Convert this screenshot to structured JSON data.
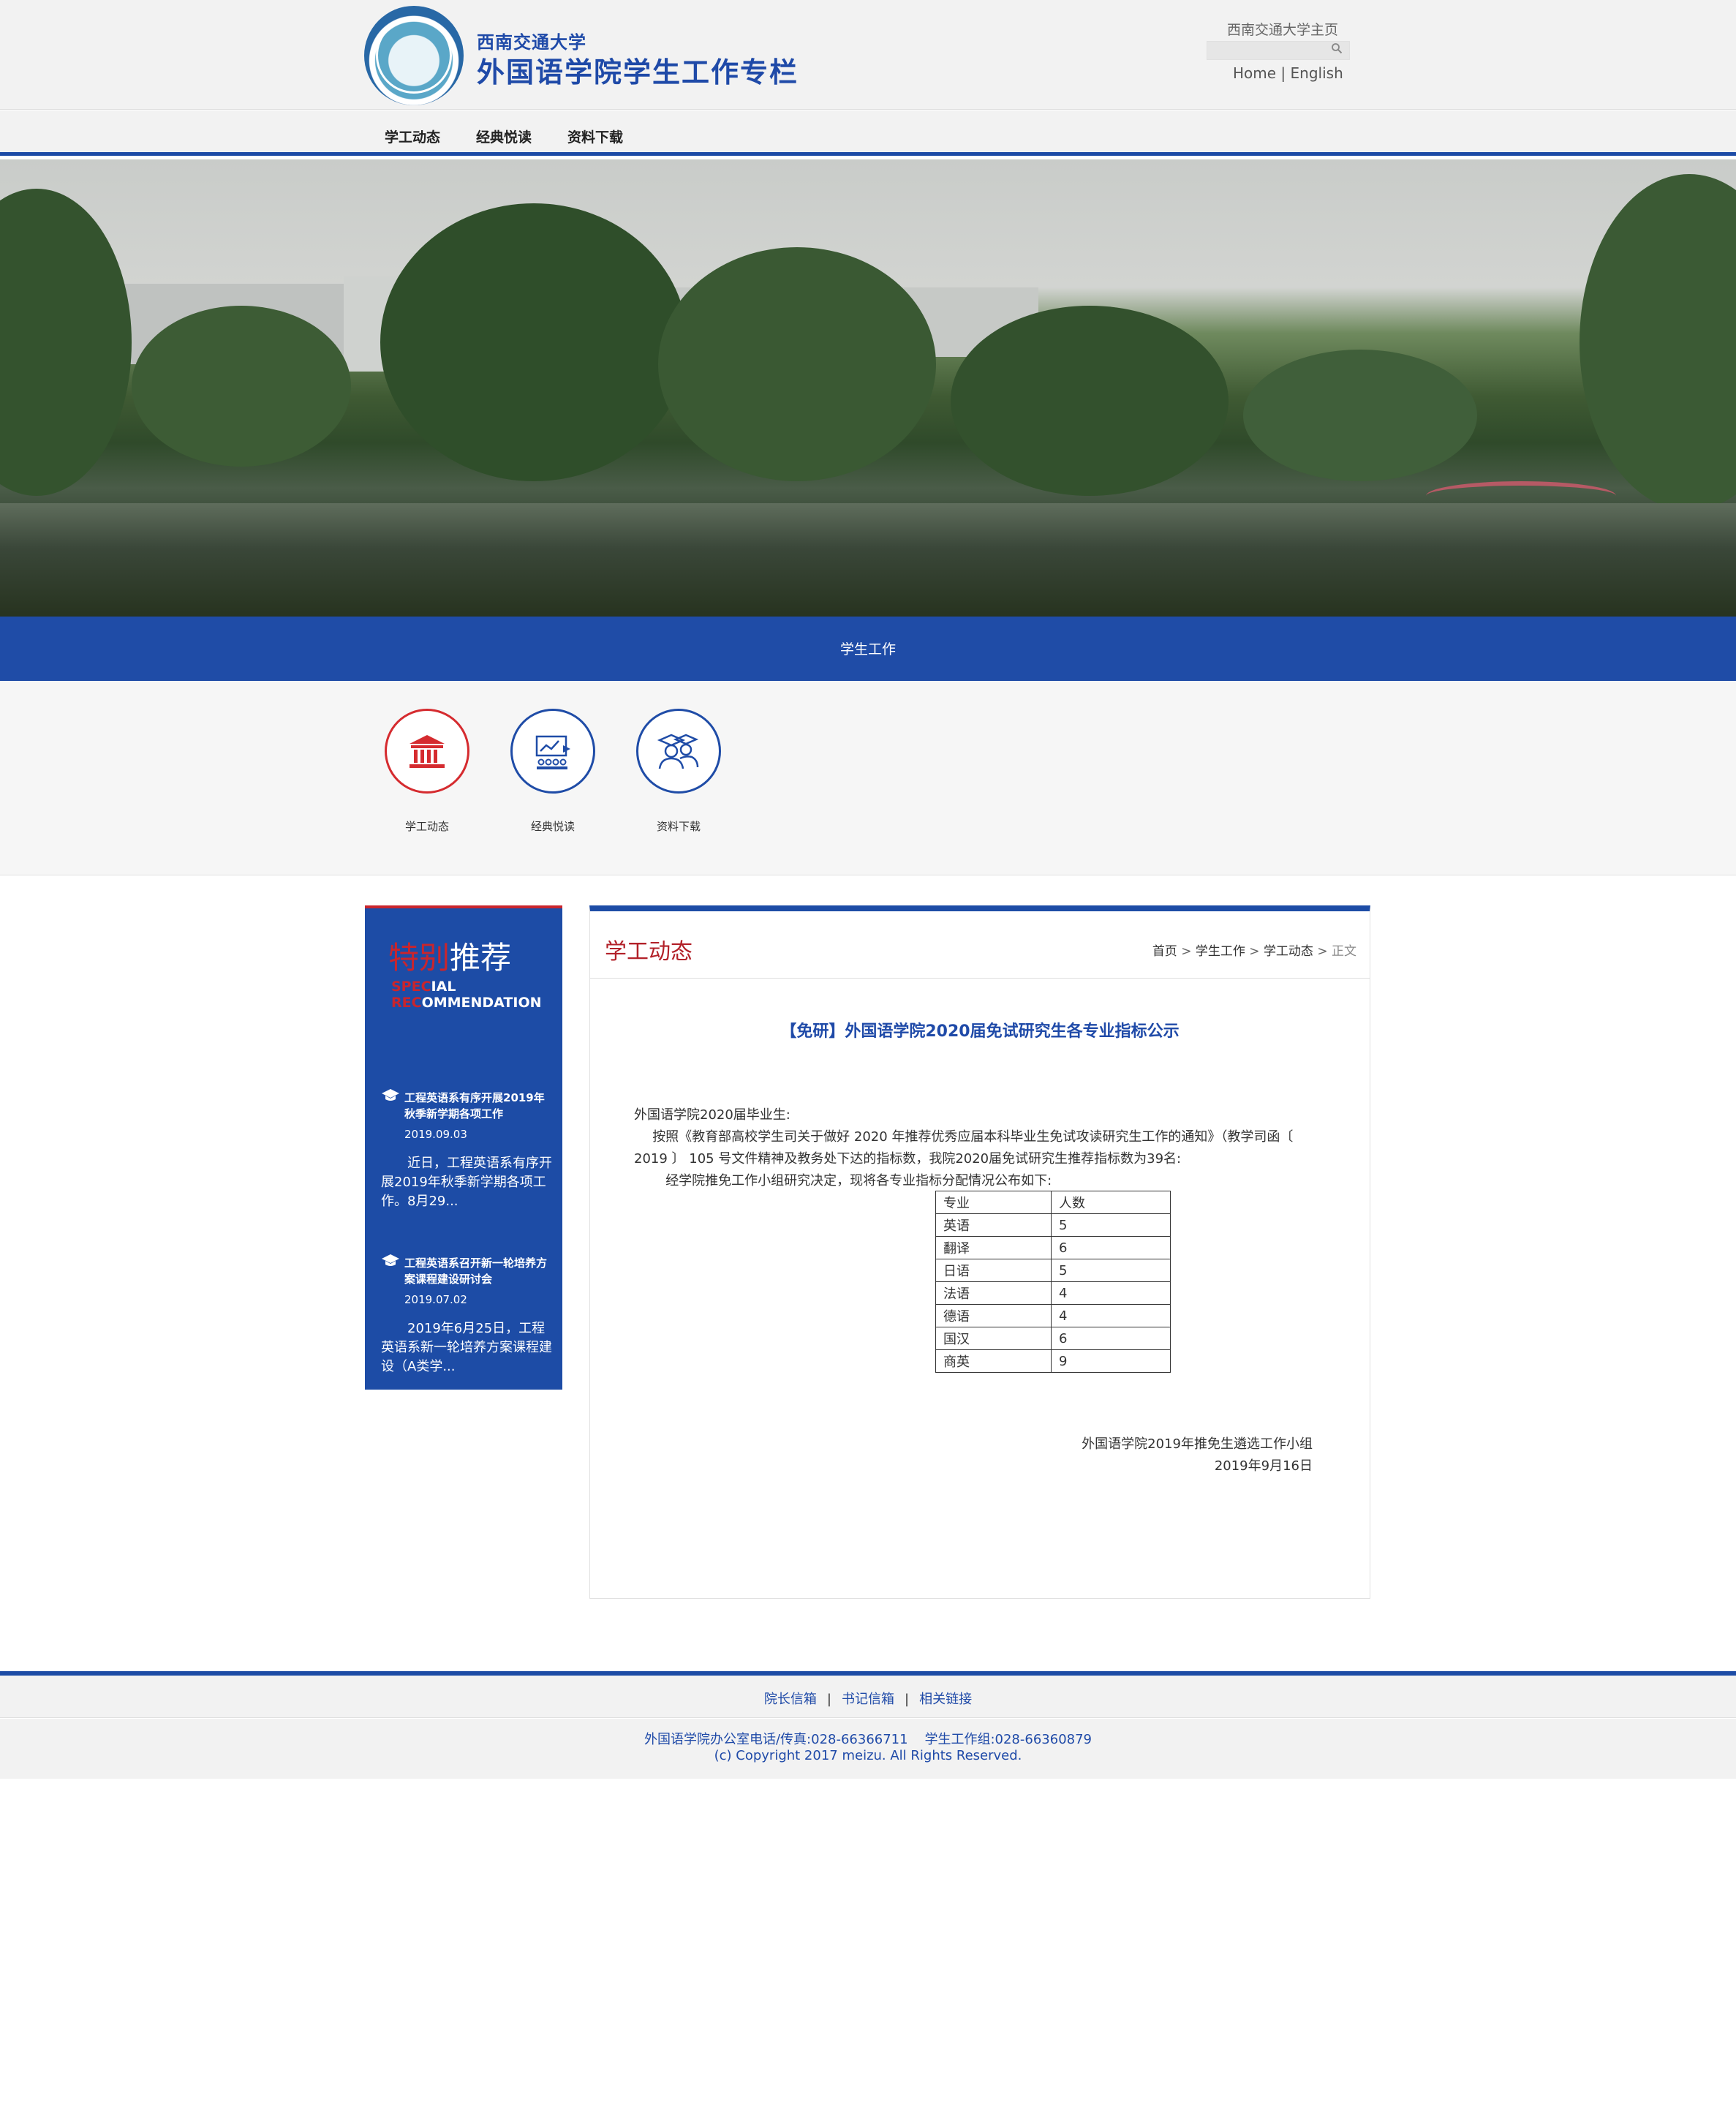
{
  "header": {
    "university": "西南交通大学",
    "site_title": "外国语学院学生工作专栏",
    "top_link": "西南交通大学主页",
    "search_placeholder": "",
    "lang_home": "Home",
    "lang_sep": "|",
    "lang_english": "English"
  },
  "nav": {
    "items": [
      {
        "label": "学工动态"
      },
      {
        "label": "经典悦读"
      },
      {
        "label": "资料下载"
      }
    ]
  },
  "band": {
    "label": "学生工作"
  },
  "quick_links": [
    {
      "label": "学工动态",
      "icon": "building-icon",
      "color": "#d52b2f"
    },
    {
      "label": "经典悦读",
      "icon": "reading-icon",
      "color": "#1f4ca7"
    },
    {
      "label": "资料下载",
      "icon": "graduates-icon",
      "color": "#1f4ca7"
    }
  ],
  "sidebar": {
    "title_part1": "特别",
    "title_part2": "推荐",
    "en_line1_red": "SPEC",
    "en_line1_white": "IAL",
    "en_line2_red": "REC",
    "en_line2_white": "OMMENDATION",
    "news": [
      {
        "title": "工程英语系有序开展2019年秋季新学期各项工作",
        "date": "2019.09.03",
        "summary": "近日，工程英语系有序开展2019年秋季新学期各项工作。8月29..."
      },
      {
        "title": "工程英语系召开新一轮培养方案课程建设研讨会",
        "date": "2019.07.02",
        "summary": "2019年6月25日，工程英语系新一轮培养方案课程建设（A类学..."
      }
    ]
  },
  "main": {
    "section_title": "学工动态",
    "breadcrumb": {
      "home": "首页",
      "level1": "学生工作",
      "level2": "学工动态",
      "current": "正文",
      "sep": ">"
    },
    "article": {
      "title": "【免研】外国语学院2020届免试研究生各专业指标公示",
      "greeting": "外国语学院2020届毕业生:",
      "para1": "按照《教育部高校学生司关于做好 2020 年推荐优秀应届本科毕业生免试攻读研究生工作的通知》（教学司函〔 2019 〕 105 号文件精神及教务处下达的指标数，我院2020届免试研究生推荐指标数为39名:",
      "para2": "经学院推免工作小组研究决定，现将各专业指标分配情况公布如下:",
      "table_header": [
        "专业",
        "人数"
      ],
      "table_rows": [
        [
          "英语",
          "5"
        ],
        [
          "翻译",
          "6"
        ],
        [
          "日语",
          "5"
        ],
        [
          "法语",
          "4"
        ],
        [
          "德语",
          "4"
        ],
        [
          "国汉",
          "6"
        ],
        [
          "商英",
          "9"
        ]
      ],
      "signature": "外国语学院2019年推免生遴选工作小组",
      "sign_date": "2019年9月16日"
    }
  },
  "footer": {
    "links": [
      "院长信箱",
      "书记信箱",
      "相关链接"
    ],
    "link_sep": "|",
    "contact": "外国语学院办公室电话/传真:028-66366711    学生工作组:028-66360879",
    "copyright": "(c) Copyright 2017 meizu. All Rights Reserved."
  },
  "colors": {
    "brand_blue": "#1d4ca6",
    "accent_red": "#c9252d"
  }
}
